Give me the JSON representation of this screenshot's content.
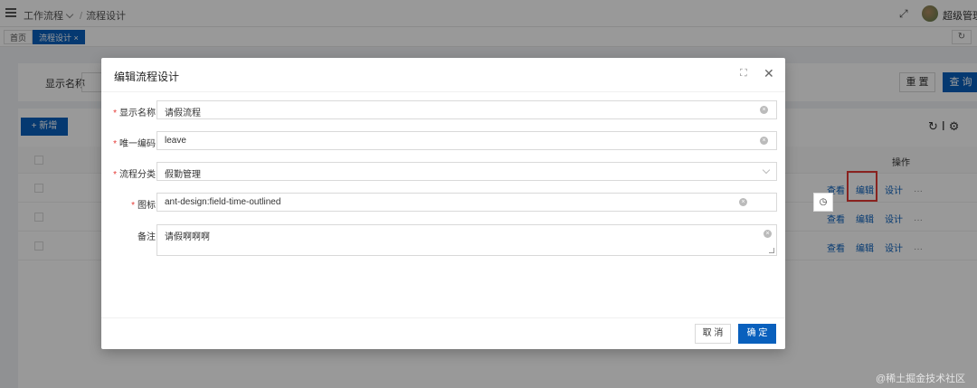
{
  "header": {
    "breadcrumb_root": "工作流程",
    "breadcrumb_separator": "/",
    "breadcrumb_current": "流程设计",
    "user_name": "超级管理",
    "fullscreen_icon": "fullscreen-icon"
  },
  "tabs": [
    {
      "label": "首页"
    },
    {
      "label": "流程设计 ×",
      "active": true
    }
  ],
  "search": {
    "label": "显示名称",
    "reset_label": "重 置",
    "query_label": "查 询"
  },
  "table": {
    "add_label": "+ 新增",
    "ops_header": "操作",
    "row_actions": [
      "查看",
      "编辑",
      "设计",
      "···"
    ]
  },
  "modal": {
    "title": "编辑流程设计",
    "fields": [
      {
        "label": "显示名称",
        "value": "请假流程",
        "required": true
      },
      {
        "label": "唯一编码",
        "value": "leave",
        "required": true
      },
      {
        "label": "流程分类",
        "value": "假勤管理",
        "required": true
      },
      {
        "label": "图标",
        "value": "ant-design:field-time-outlined",
        "required": true
      },
      {
        "label": "备注",
        "value": "请假啊啊啊",
        "required": false
      }
    ],
    "cancel_label": "取 消",
    "ok_label": "确 定"
  },
  "colors": {
    "primary": "#0960bd",
    "required": "#e53935",
    "highlight": "#e53935"
  },
  "watermark": "@稀土掘金技术社区"
}
